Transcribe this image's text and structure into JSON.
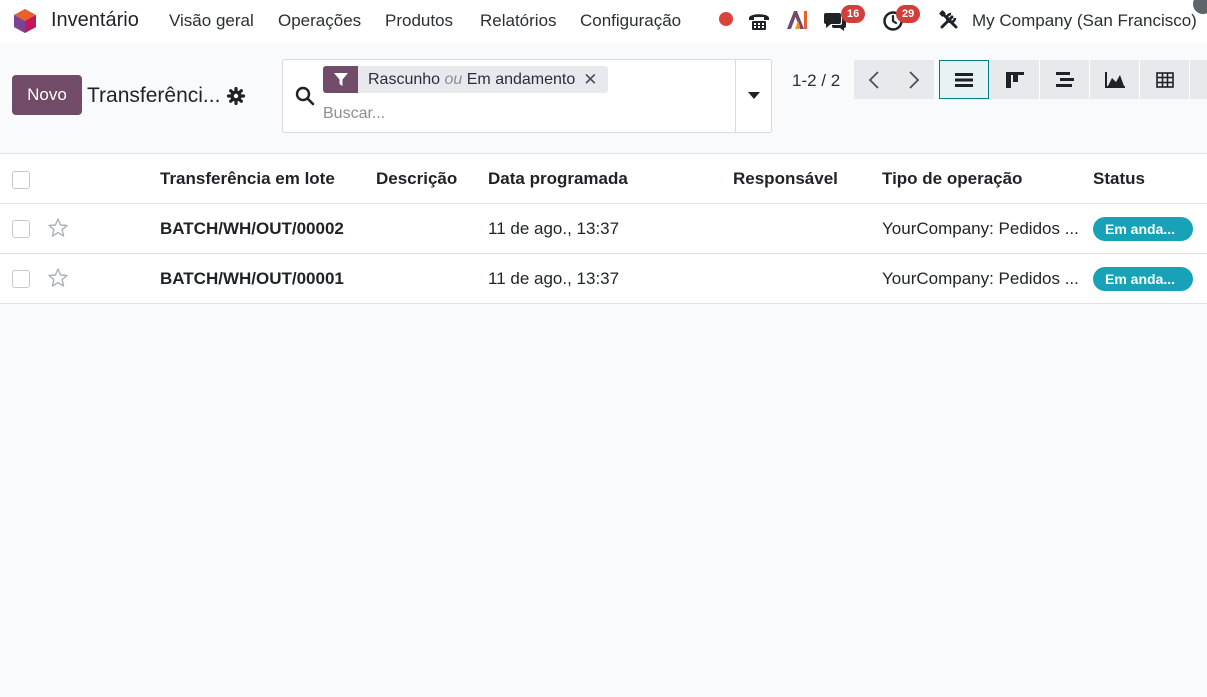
{
  "navbar": {
    "app_name": "Inventário",
    "menu": [
      "Visão geral",
      "Operações",
      "Produtos",
      "Relatórios",
      "Configuração"
    ],
    "messages_count": "16",
    "activities_count": "29",
    "company": "My Company (San Francisco)",
    "icons": [
      "status-dot-icon",
      "phone-icon",
      "ai-icon",
      "chat-icon",
      "clock-icon",
      "tools-icon"
    ],
    "colors": {
      "brand": "#714b67",
      "badge": "#d23f3a",
      "status_dot": "#d9453c"
    }
  },
  "control_panel": {
    "new_button": "Novo",
    "breadcrumb": "Transferênci...",
    "search": {
      "facet_part1": "Rascunho",
      "facet_or": "ou",
      "facet_part2": "Em andamento",
      "placeholder": "Buscar..."
    },
    "pager": "1-2 / 2",
    "views": [
      "list",
      "kanban",
      "gantt",
      "graph",
      "pivot"
    ],
    "active_view": "list"
  },
  "table": {
    "columns": [
      "Transferência em lote",
      "Descrição",
      "Data programada",
      "Responsável",
      "Tipo de operação",
      "Status"
    ],
    "rows": [
      {
        "name": "BATCH/WH/OUT/00002",
        "description": "",
        "scheduled_date": "11 de ago., 13:37",
        "responsible": "",
        "operation_type": "YourCompany: Pedidos ...",
        "status": "Em anda..."
      },
      {
        "name": "BATCH/WH/OUT/00001",
        "description": "",
        "scheduled_date": "11 de ago., 13:37",
        "responsible": "",
        "operation_type": "YourCompany: Pedidos ...",
        "status": "Em anda..."
      }
    ],
    "status_color": "#17a2b8"
  }
}
